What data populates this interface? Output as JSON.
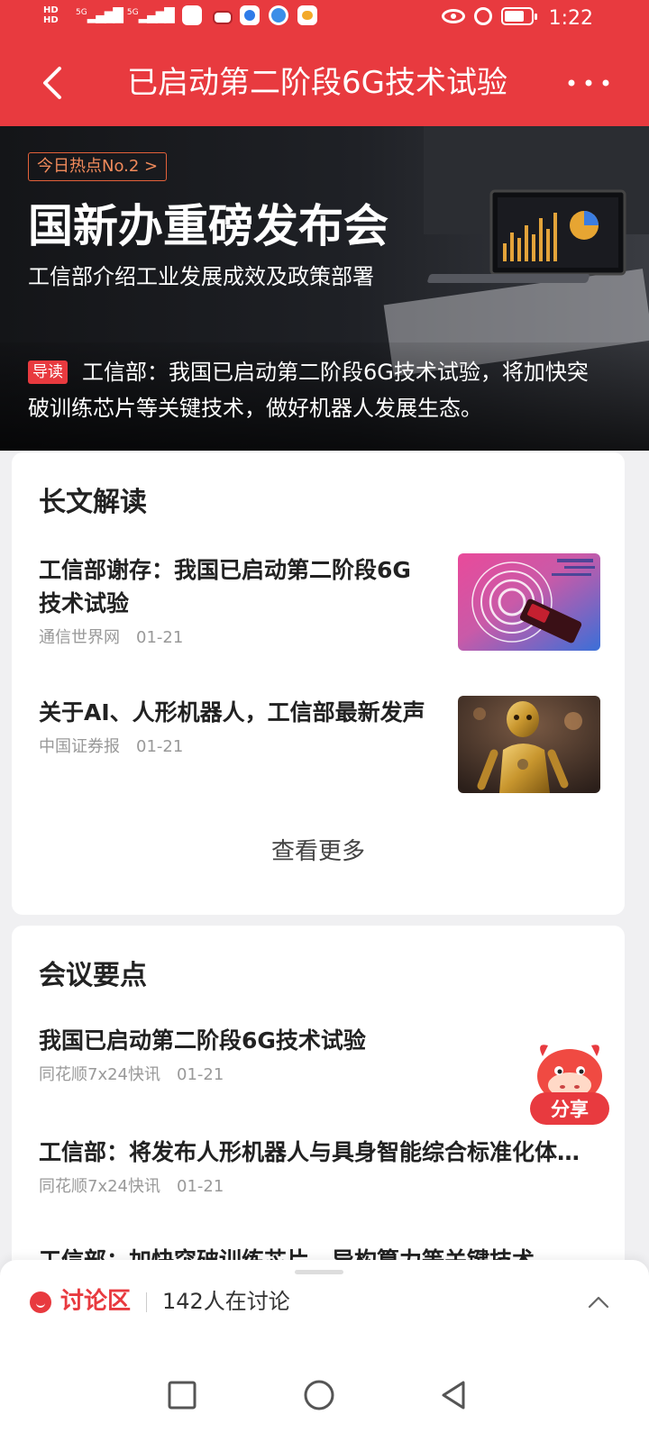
{
  "status_bar": {
    "net_labels": [
      "HD",
      "HD"
    ],
    "signal_labels": [
      "5G",
      "5G"
    ],
    "time": "1:22",
    "battery_level": 0.75
  },
  "header": {
    "title": "已启动第二阶段6G技术试验",
    "back_icon": "back-chevron-icon",
    "more_icon": "more-dots-icon"
  },
  "banner": {
    "hot_tag": "今日热点No.2 >",
    "title": "国新办重磅发布会",
    "subtitle": "工信部介绍工业发展成效及政策部署",
    "lead_badge": "导读",
    "lead_text": "工信部：我国已启动第二阶段6G技术试验，将加快突破训练芯片等关键技术，做好机器人发展生态。"
  },
  "longform": {
    "title": "长文解读",
    "articles": [
      {
        "title": "工信部谢存：我国已启动第二阶段6G技术试验",
        "source": "通信世界网",
        "date": "01-21",
        "thumb": "phone-signal-image"
      },
      {
        "title": "关于AI、人形机器人，工信部最新发声",
        "source": "中国证券报",
        "date": "01-21",
        "thumb": "golden-robot-image"
      }
    ],
    "more_label": "查看更多"
  },
  "meeting": {
    "title": "会议要点",
    "points": [
      {
        "title": "我国已启动第二阶段6G技术试验",
        "source": "同花顺7x24快讯",
        "date": "01-21"
      },
      {
        "title": "工信部：将发布人形机器人与具身智能综合标准化体系建设指南",
        "source": "同花顺7x24快讯",
        "date": "01-21"
      },
      {
        "title": "工信部：加快突破训练芯片、异构算力等关键技术",
        "source": "",
        "date": ""
      }
    ]
  },
  "share": {
    "label": "分享"
  },
  "discussion": {
    "label": "讨论区",
    "count_text": "142人在讨论"
  },
  "colors": {
    "brand_red": "#e83a3f",
    "hot_tag_orange": "#e4613a"
  }
}
